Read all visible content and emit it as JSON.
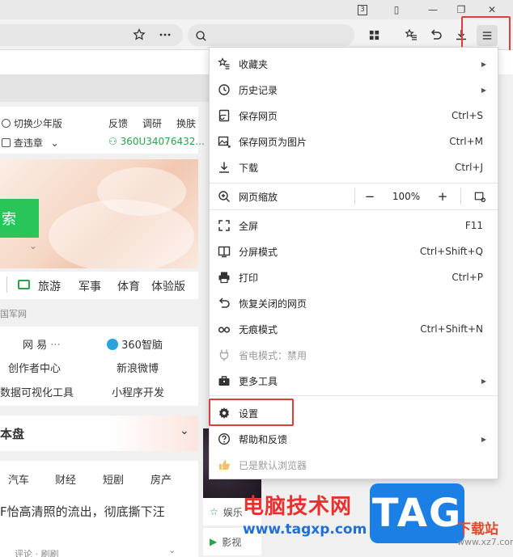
{
  "window": {
    "badge_label": "3"
  },
  "search": {
    "placeholder": ""
  },
  "page": {
    "top_left": {
      "youth_mode": "切换少年版",
      "weather": "查违章",
      "feedback": "反馈",
      "research": "调研",
      "skin": "换肤",
      "user_id": "360U34076432..."
    },
    "hero_button": "索",
    "nav_row": [
      "旅游",
      "军事",
      "体育",
      "体验版"
    ],
    "source": "国军网",
    "links_row1": [
      "网 易",
      "360智脑"
    ],
    "links_row1_more": "···",
    "links_row2": [
      "创作者中心",
      "新浪微博"
    ],
    "links_row3": [
      "数据可视化工具",
      "小程序开发"
    ],
    "section_title": "本盘",
    "tabs": [
      "汽车",
      "财经",
      "短剧",
      "房产"
    ],
    "headline": "F怡高清照的流出，彻底撕下汪",
    "footer_hint": "评论 · 刷刷",
    "side_items": [
      "娱乐",
      "影视"
    ]
  },
  "menu": {
    "items": [
      {
        "label": "收藏夹",
        "shortcut": "",
        "submenu": true,
        "icon": "star-list-icon"
      },
      {
        "label": "历史记录",
        "shortcut": "",
        "submenu": true,
        "icon": "clock-icon"
      },
      {
        "label": "保存网页",
        "shortcut": "Ctrl+S",
        "submenu": false,
        "icon": "save-page-icon"
      },
      {
        "label": "保存网页为图片",
        "shortcut": "Ctrl+M",
        "submenu": false,
        "icon": "image-icon"
      },
      {
        "label": "下载",
        "shortcut": "Ctrl+J",
        "submenu": false,
        "icon": "download-icon"
      }
    ],
    "zoom": {
      "label": "网页缩放",
      "minus": "−",
      "value": "100%",
      "plus": "+"
    },
    "items2": [
      {
        "label": "全屏",
        "shortcut": "F11",
        "icon": "fullscreen-icon"
      },
      {
        "label": "分屏模式",
        "shortcut": "Ctrl+Shift+Q",
        "icon": "split-screen-icon"
      },
      {
        "label": "打印",
        "shortcut": "Ctrl+P",
        "icon": "print-icon"
      },
      {
        "label": "恢复关闭的网页",
        "shortcut": "",
        "icon": "restore-icon"
      },
      {
        "label": "无痕模式",
        "shortcut": "Ctrl+Shift+N",
        "icon": "incognito-icon"
      },
      {
        "label": "省电模式：禁用",
        "shortcut": "",
        "icon": "power-save-icon"
      },
      {
        "label": "更多工具",
        "shortcut": "",
        "icon": "toolbox-icon"
      }
    ],
    "items3": [
      {
        "label": "设置",
        "icon": "gear-icon"
      },
      {
        "label": "帮助和反馈",
        "icon": "help-icon"
      },
      {
        "label": "已是默认浏览器",
        "icon": "thumbs-up-icon"
      }
    ],
    "submenu_arrow": "▶"
  },
  "watermark": {
    "site_name": "电脑技术网",
    "url": "www.tagxp.com",
    "tag": "TAG",
    "download": "下载站",
    "xz": "www.xz7.com"
  },
  "colors": {
    "highlight_box": "#e03c3c",
    "green_button": "#2ac558",
    "tag_blue": "#1b7fe6"
  }
}
